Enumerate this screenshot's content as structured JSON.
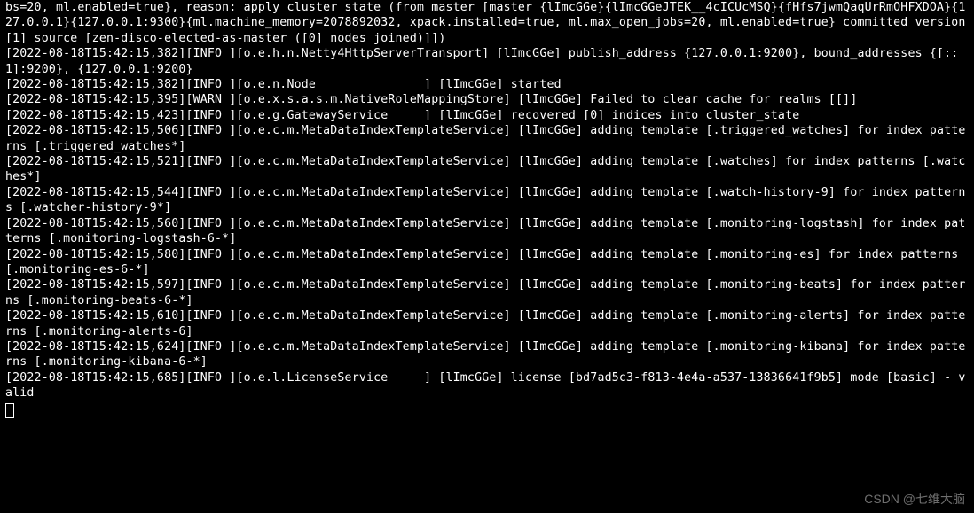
{
  "log_lines": [
    "bs=20, ml.enabled=true}, reason: apply cluster state (from master [master {lImcGGe}{lImcGGeJTEK__4cICUcMSQ}{fHfs7jwmQaqUrRmOHFXDOA}{127.0.0.1}{127.0.0.1:9300}{ml.machine_memory=2078892032, xpack.installed=true, ml.max_open_jobs=20, ml.enabled=true} committed version [1] source [zen-disco-elected-as-master ([0] nodes joined)]])",
    "[2022-08-18T15:42:15,382][INFO ][o.e.h.n.Netty4HttpServerTransport] [lImcGGe] publish_address {127.0.0.1:9200}, bound_addresses {[::1]:9200}, {127.0.0.1:9200}",
    "[2022-08-18T15:42:15,382][INFO ][o.e.n.Node               ] [lImcGGe] started",
    "[2022-08-18T15:42:15,395][WARN ][o.e.x.s.a.s.m.NativeRoleMappingStore] [lImcGGe] Failed to clear cache for realms [[]]",
    "[2022-08-18T15:42:15,423][INFO ][o.e.g.GatewayService     ] [lImcGGe] recovered [0] indices into cluster_state",
    "[2022-08-18T15:42:15,506][INFO ][o.e.c.m.MetaDataIndexTemplateService] [lImcGGe] adding template [.triggered_watches] for index patterns [.triggered_watches*]",
    "[2022-08-18T15:42:15,521][INFO ][o.e.c.m.MetaDataIndexTemplateService] [lImcGGe] adding template [.watches] for index patterns [.watches*]",
    "[2022-08-18T15:42:15,544][INFO ][o.e.c.m.MetaDataIndexTemplateService] [lImcGGe] adding template [.watch-history-9] for index patterns [.watcher-history-9*]",
    "[2022-08-18T15:42:15,560][INFO ][o.e.c.m.MetaDataIndexTemplateService] [lImcGGe] adding template [.monitoring-logstash] for index patterns [.monitoring-logstash-6-*]",
    "[2022-08-18T15:42:15,580][INFO ][o.e.c.m.MetaDataIndexTemplateService] [lImcGGe] adding template [.monitoring-es] for index patterns [.monitoring-es-6-*]",
    "[2022-08-18T15:42:15,597][INFO ][o.e.c.m.MetaDataIndexTemplateService] [lImcGGe] adding template [.monitoring-beats] for index patterns [.monitoring-beats-6-*]",
    "[2022-08-18T15:42:15,610][INFO ][o.e.c.m.MetaDataIndexTemplateService] [lImcGGe] adding template [.monitoring-alerts] for index patterns [.monitoring-alerts-6]",
    "[2022-08-18T15:42:15,624][INFO ][o.e.c.m.MetaDataIndexTemplateService] [lImcGGe] adding template [.monitoring-kibana] for index patterns [.monitoring-kibana-6-*]",
    "[2022-08-18T15:42:15,685][INFO ][o.e.l.LicenseService     ] [lImcGGe] license [bd7ad5c3-f813-4e4a-a537-13836641f9b5] mode [basic] - valid"
  ],
  "watermark": "CSDN @七维大脑"
}
